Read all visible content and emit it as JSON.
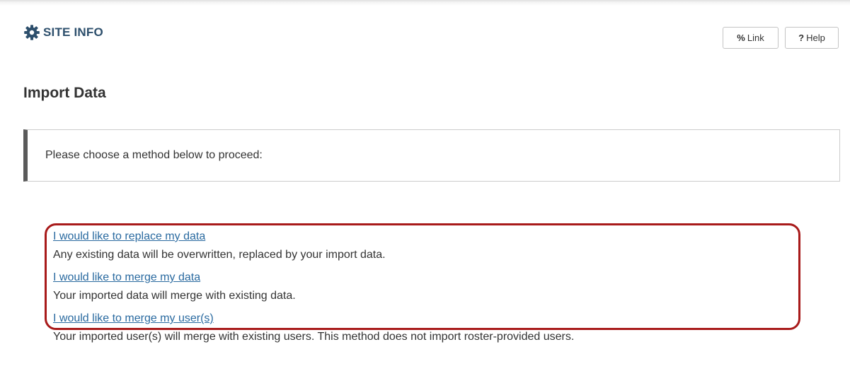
{
  "header": {
    "tool_title": "SITE INFO",
    "tool_icon": "gear-icon",
    "link_button": {
      "icon": "link-icon",
      "glyph": "%",
      "label": "Link"
    },
    "help_button": {
      "icon": "help-icon",
      "glyph": "?",
      "label": "Help"
    }
  },
  "main": {
    "page_title": "Import Data",
    "instruction": "Please choose a method below to proceed:",
    "options": [
      {
        "link": "I would like to replace my data",
        "description": "Any existing data will be overwritten, replaced by your import data."
      },
      {
        "link": "I would like to merge my data",
        "description": "Your imported data will merge with existing data."
      },
      {
        "link": "I would like to merge my user(s)",
        "description": "Your imported user(s) will merge with existing users. This method does not import roster-provided users."
      }
    ]
  },
  "colors": {
    "title_blue": "#2d4f6c",
    "link_blue": "#2a6aa0",
    "highlight_red": "#a81a1a",
    "instruction_bar": "#5a5a5a"
  }
}
